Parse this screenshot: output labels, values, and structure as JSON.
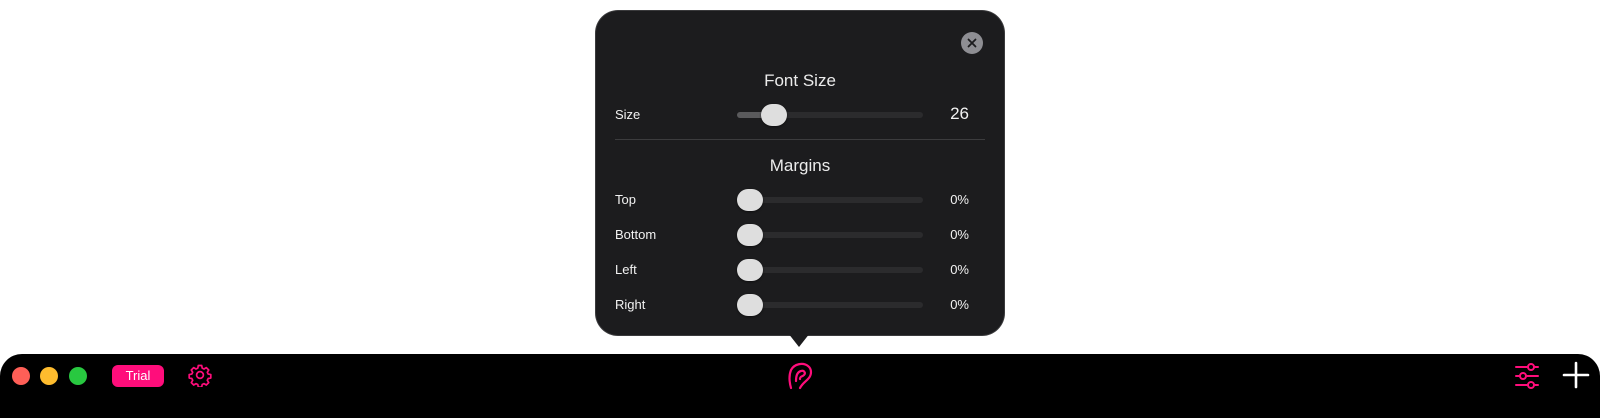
{
  "colors": {
    "accent": "#ff0d7b",
    "close_red": "#ff5f57",
    "minimize_yellow": "#febc2e",
    "zoom_green": "#28c840",
    "popover_bg": "#1c1c1e"
  },
  "popover": {
    "close_icon": "close-x-icon",
    "font_section": {
      "title": "Font Size",
      "size_row": {
        "label": "Size",
        "value": "26",
        "level": 0.15
      }
    },
    "margins_section": {
      "title": "Margins",
      "rows": [
        {
          "label": "Top",
          "value": "0%",
          "level": 0
        },
        {
          "label": "Bottom",
          "value": "0%",
          "level": 0
        },
        {
          "label": "Left",
          "value": "0%",
          "level": 0
        },
        {
          "label": "Right",
          "value": "0%",
          "level": 0
        }
      ]
    }
  },
  "toolbar": {
    "trial_label": "Trial",
    "settings_icon": "gear-icon",
    "center_icon": "ear-icon",
    "adjust_icon": "sliders-icon",
    "add_icon": "plus-icon"
  }
}
